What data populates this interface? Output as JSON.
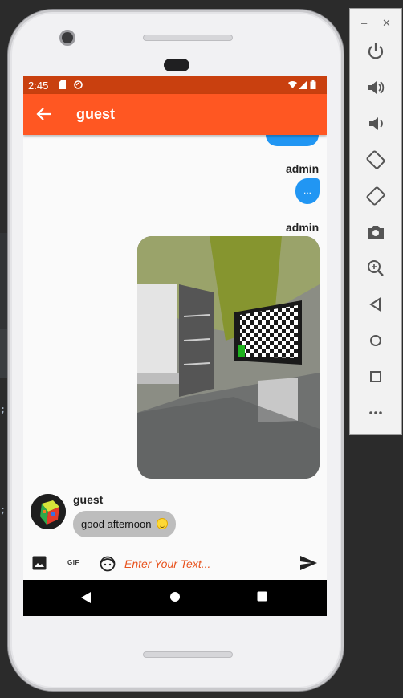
{
  "status_bar": {
    "time": "2:45"
  },
  "app_bar": {
    "title": "guest",
    "back_icon": "arrow-back-icon"
  },
  "messages": [
    {
      "sender": "admin",
      "type": "text",
      "text": "..."
    },
    {
      "sender": "admin",
      "type": "image"
    },
    {
      "sender": "guest",
      "type": "text",
      "text": "good afternoon"
    }
  ],
  "composer": {
    "placeholder": "Enter Your Text...",
    "gif_label": "GIF"
  },
  "colors": {
    "accent": "#ff5722",
    "status_bar": "#c9400f",
    "sent_bubble": "#2196f3",
    "received_bubble": "#bdbdbd"
  },
  "emulator_panel": {
    "buttons": [
      "power-icon",
      "volume-up-icon",
      "volume-down-icon",
      "rotate-left-icon",
      "rotate-right-icon",
      "camera-icon",
      "zoom-icon",
      "back-icon",
      "home-icon",
      "overview-icon",
      "more-icon"
    ]
  }
}
